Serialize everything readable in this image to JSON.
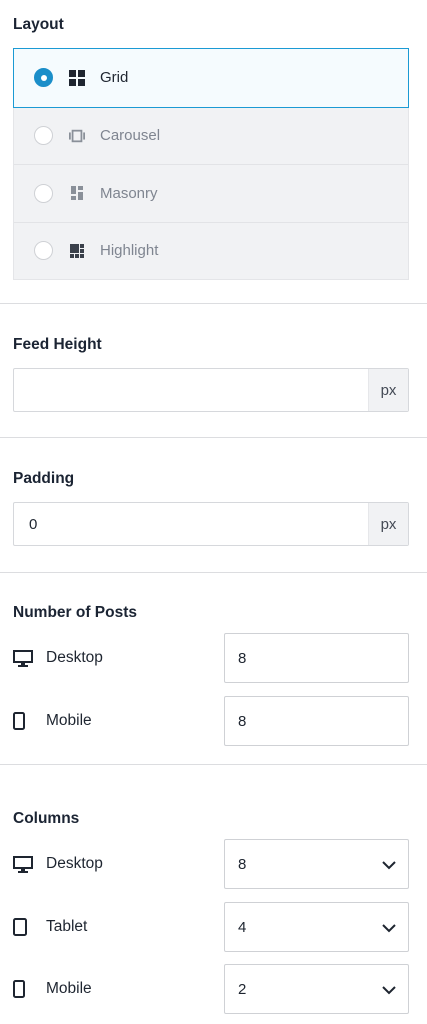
{
  "layout": {
    "title": "Layout",
    "options": [
      {
        "label": "Grid",
        "selected": true,
        "icon": "grid-icon"
      },
      {
        "label": "Carousel",
        "selected": false,
        "icon": "carousel-icon"
      },
      {
        "label": "Masonry",
        "selected": false,
        "icon": "masonry-icon"
      },
      {
        "label": "Highlight",
        "selected": false,
        "icon": "highlight-icon"
      }
    ]
  },
  "feed_height": {
    "title": "Feed Height",
    "value": "",
    "unit": "px"
  },
  "padding": {
    "title": "Padding",
    "value": "0",
    "unit": "px"
  },
  "number_of_posts": {
    "title": "Number of Posts",
    "rows": [
      {
        "label": "Desktop",
        "value": "8",
        "icon": "desktop-icon"
      },
      {
        "label": "Mobile",
        "value": "8",
        "icon": "mobile-icon"
      }
    ]
  },
  "columns": {
    "title": "Columns",
    "rows": [
      {
        "label": "Desktop",
        "value": "8",
        "icon": "desktop-icon"
      },
      {
        "label": "Tablet",
        "value": "4",
        "icon": "tablet-icon"
      },
      {
        "label": "Mobile",
        "value": "2",
        "icon": "mobile-icon"
      }
    ]
  },
  "colors": {
    "accent": "#1b8ec9",
    "border_selected": "#1b9ad4"
  }
}
